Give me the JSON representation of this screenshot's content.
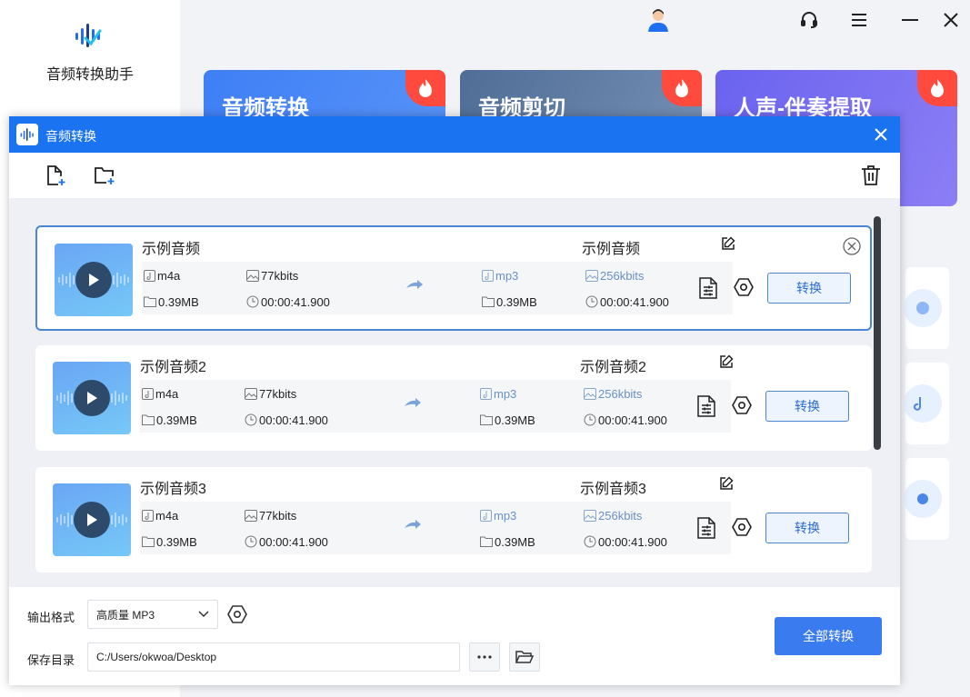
{
  "app": {
    "name": "音频转换助手"
  },
  "feature_cards": [
    {
      "title": "音频转换",
      "color": "#3e7ff6"
    },
    {
      "title": "音频剪切",
      "color": "#5b7aa6"
    },
    {
      "title": "人声-伴奏提取",
      "color": "#6a63ef"
    }
  ],
  "dialog": {
    "title": "音频转换",
    "accent": "#1a73f0",
    "files": [
      {
        "name": "示例音频",
        "src_format": "m4a",
        "src_bitrate": "77kbits",
        "src_size": "0.39MB",
        "src_duration": "00:00:41.900",
        "out_name": "示例音频",
        "dst_format": "mp3",
        "dst_bitrate": "256kbits",
        "dst_size": "0.39MB",
        "dst_duration": "00:00:41.900",
        "convert_label": "转换"
      },
      {
        "name": "示例音频2",
        "src_format": "m4a",
        "src_bitrate": "77kbits",
        "src_size": "0.39MB",
        "src_duration": "00:00:41.900",
        "out_name": "示例音频2",
        "dst_format": "mp3",
        "dst_bitrate": "256kbits",
        "dst_size": "0.39MB",
        "dst_duration": "00:00:41.900",
        "convert_label": "转换"
      },
      {
        "name": "示例音频3",
        "src_format": "m4a",
        "src_bitrate": "77kbits",
        "src_size": "0.39MB",
        "src_duration": "00:00:41.900",
        "out_name": "示例音频3",
        "dst_format": "mp3",
        "dst_bitrate": "256kbits",
        "dst_size": "0.39MB",
        "dst_duration": "00:00:41.900",
        "convert_label": "转换"
      }
    ],
    "output_format_label": "输出格式",
    "output_format_value": "高质量 MP3",
    "save_dir_label": "保存目录",
    "save_dir_value": "C:/Users/okwoa/Desktop",
    "convert_all_label": "全部转换"
  }
}
